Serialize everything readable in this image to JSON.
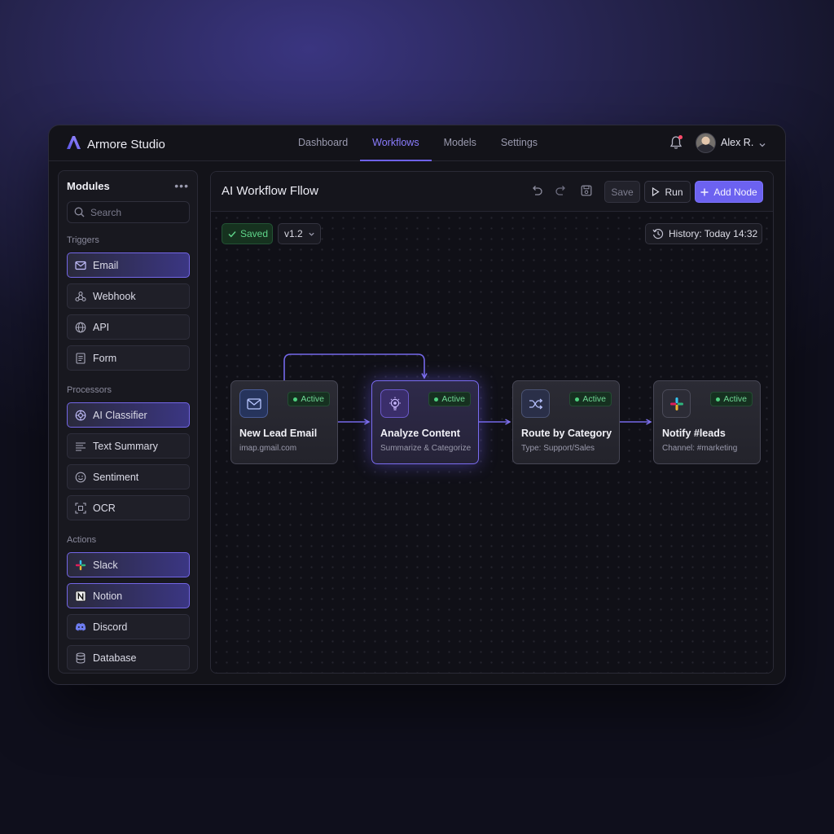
{
  "app": {
    "name": "Armore Studio"
  },
  "nav": {
    "tabs": [
      "Dashboard",
      "Workflows",
      "Models",
      "Settings"
    ],
    "active": "Workflows"
  },
  "user": {
    "name": "Alex R."
  },
  "sidebar": {
    "title": "Modules",
    "search_placeholder": "Search",
    "sections": [
      {
        "label": "Triggers",
        "items": [
          {
            "label": "Email",
            "icon": "mail-icon",
            "selected": true
          },
          {
            "label": "Webhook",
            "icon": "webhook-icon",
            "selected": false
          },
          {
            "label": "API",
            "icon": "globe-icon",
            "selected": false
          },
          {
            "label": "Form",
            "icon": "form-icon",
            "selected": false
          }
        ]
      },
      {
        "label": "Processors",
        "items": [
          {
            "label": "AI Classifier",
            "icon": "ai-chip-icon",
            "selected": true
          },
          {
            "label": "Text Summary",
            "icon": "text-lines-icon",
            "selected": false
          },
          {
            "label": "Sentiment",
            "icon": "smiley-icon",
            "selected": false
          },
          {
            "label": "OCR",
            "icon": "scan-icon",
            "selected": false
          }
        ]
      },
      {
        "label": "Actions",
        "items": [
          {
            "label": "Slack",
            "icon": "slack-icon",
            "selected": true
          },
          {
            "label": "Notion",
            "icon": "notion-icon",
            "selected": true
          },
          {
            "label": "Discord",
            "icon": "discord-icon",
            "selected": false
          },
          {
            "label": "Database",
            "icon": "database-icon",
            "selected": false
          }
        ]
      }
    ]
  },
  "workflow": {
    "title": "AI Workflow Fllow",
    "toolbar": {
      "save_label": "Save",
      "run_label": "Run",
      "add_node_label": "Add Node"
    },
    "status": {
      "saved_label": "Saved",
      "version": "v1.2",
      "history_label": "History: Today 14:32"
    },
    "nodes": [
      {
        "title": "New Lead Email",
        "subtitle": "imap.gmail.com",
        "badge": "Active",
        "icon": "mail-icon"
      },
      {
        "title": "Analyze Content",
        "subtitle": "Summarize & Categorize",
        "badge": "Active",
        "icon": "ai-bulb-icon"
      },
      {
        "title": "Route by Category",
        "subtitle": "Type: Support/Sales",
        "badge": "Active",
        "icon": "shuffle-icon"
      },
      {
        "title": "Notify #leads",
        "subtitle": "Channel: #marketing",
        "badge": "Active",
        "icon": "slack-icon"
      }
    ]
  },
  "colors": {
    "accent": "#6c62f0",
    "active_green": "#4ed07e",
    "alert_red": "#ff4a6a"
  }
}
